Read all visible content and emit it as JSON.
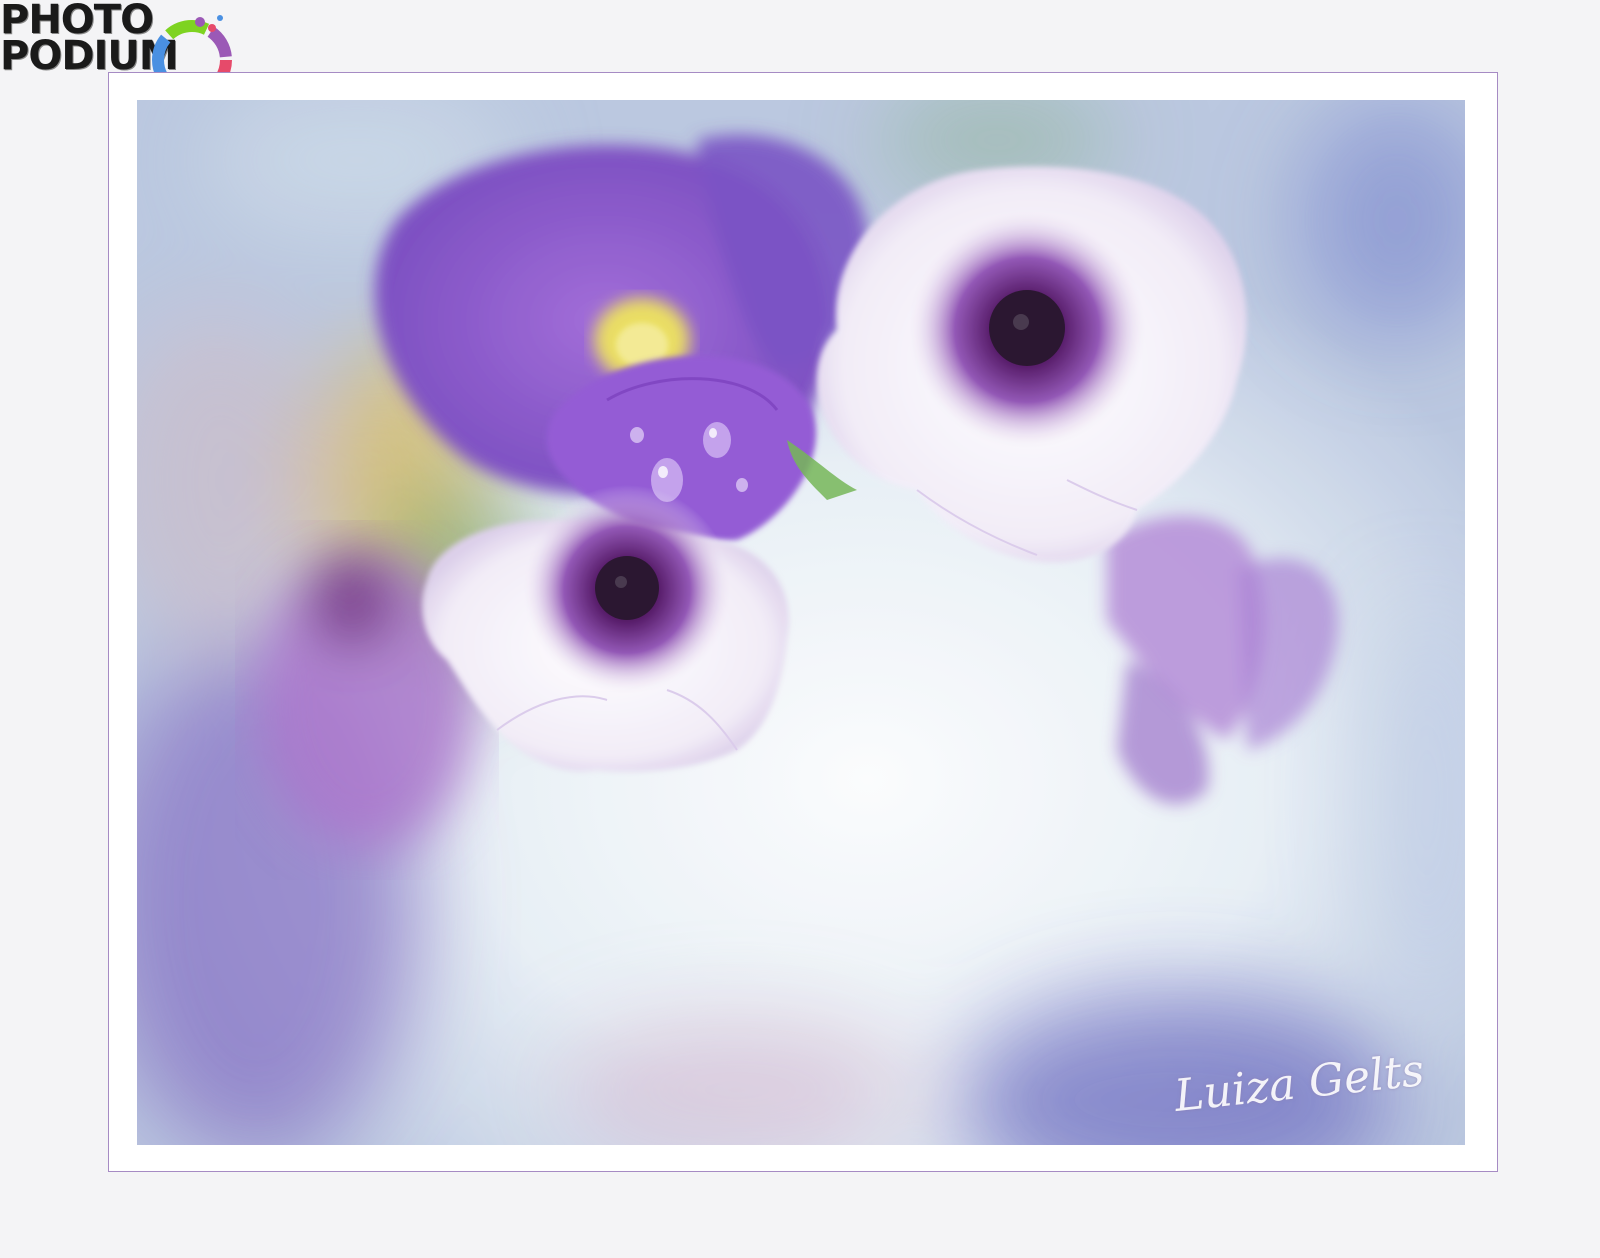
{
  "logo": {
    "line1": "PHOTO",
    "line2": "PODIUM"
  },
  "photo": {
    "signature": "Luiza Gelts",
    "colors": {
      "purple": "#8a55c8",
      "violet": "#6a3fb0",
      "white_petal": "#f3eef8",
      "center": "#3a0a4a",
      "mist": "#e8f0f6",
      "yellow": "#e8d84a",
      "green": "#6ab04a"
    }
  },
  "frame": {
    "border_color": "#a68bc4"
  }
}
